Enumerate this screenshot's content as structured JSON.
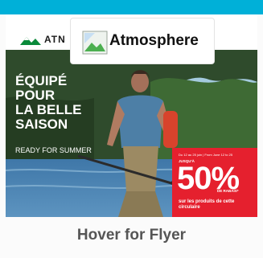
{
  "card": {
    "image_alt": "Atmosphere",
    "caption": "Hover for Flyer"
  },
  "flyer": {
    "brand_partial": "ATN",
    "headline": [
      "ÉQUIPÉ",
      "POUR",
      "LA BELLE",
      "SAISON"
    ],
    "subhead": "READY FOR SUMMER",
    "promo": {
      "dates": "Du 12 au 25 juin | From June 12 to 25",
      "upto": "JUSQU'À",
      "percent": "50%",
      "off": "DE RABAIS*",
      "description": "sur les produits de cette circulaire"
    }
  },
  "colors": {
    "accent_teal": "#00b0d8",
    "promo_red": "#e5202e",
    "forest_dark": "#2e4a2c",
    "lake_blue": "#4f86b4"
  },
  "icons": [
    "broken-image-icon",
    "atmosphere-logo-icon"
  ]
}
